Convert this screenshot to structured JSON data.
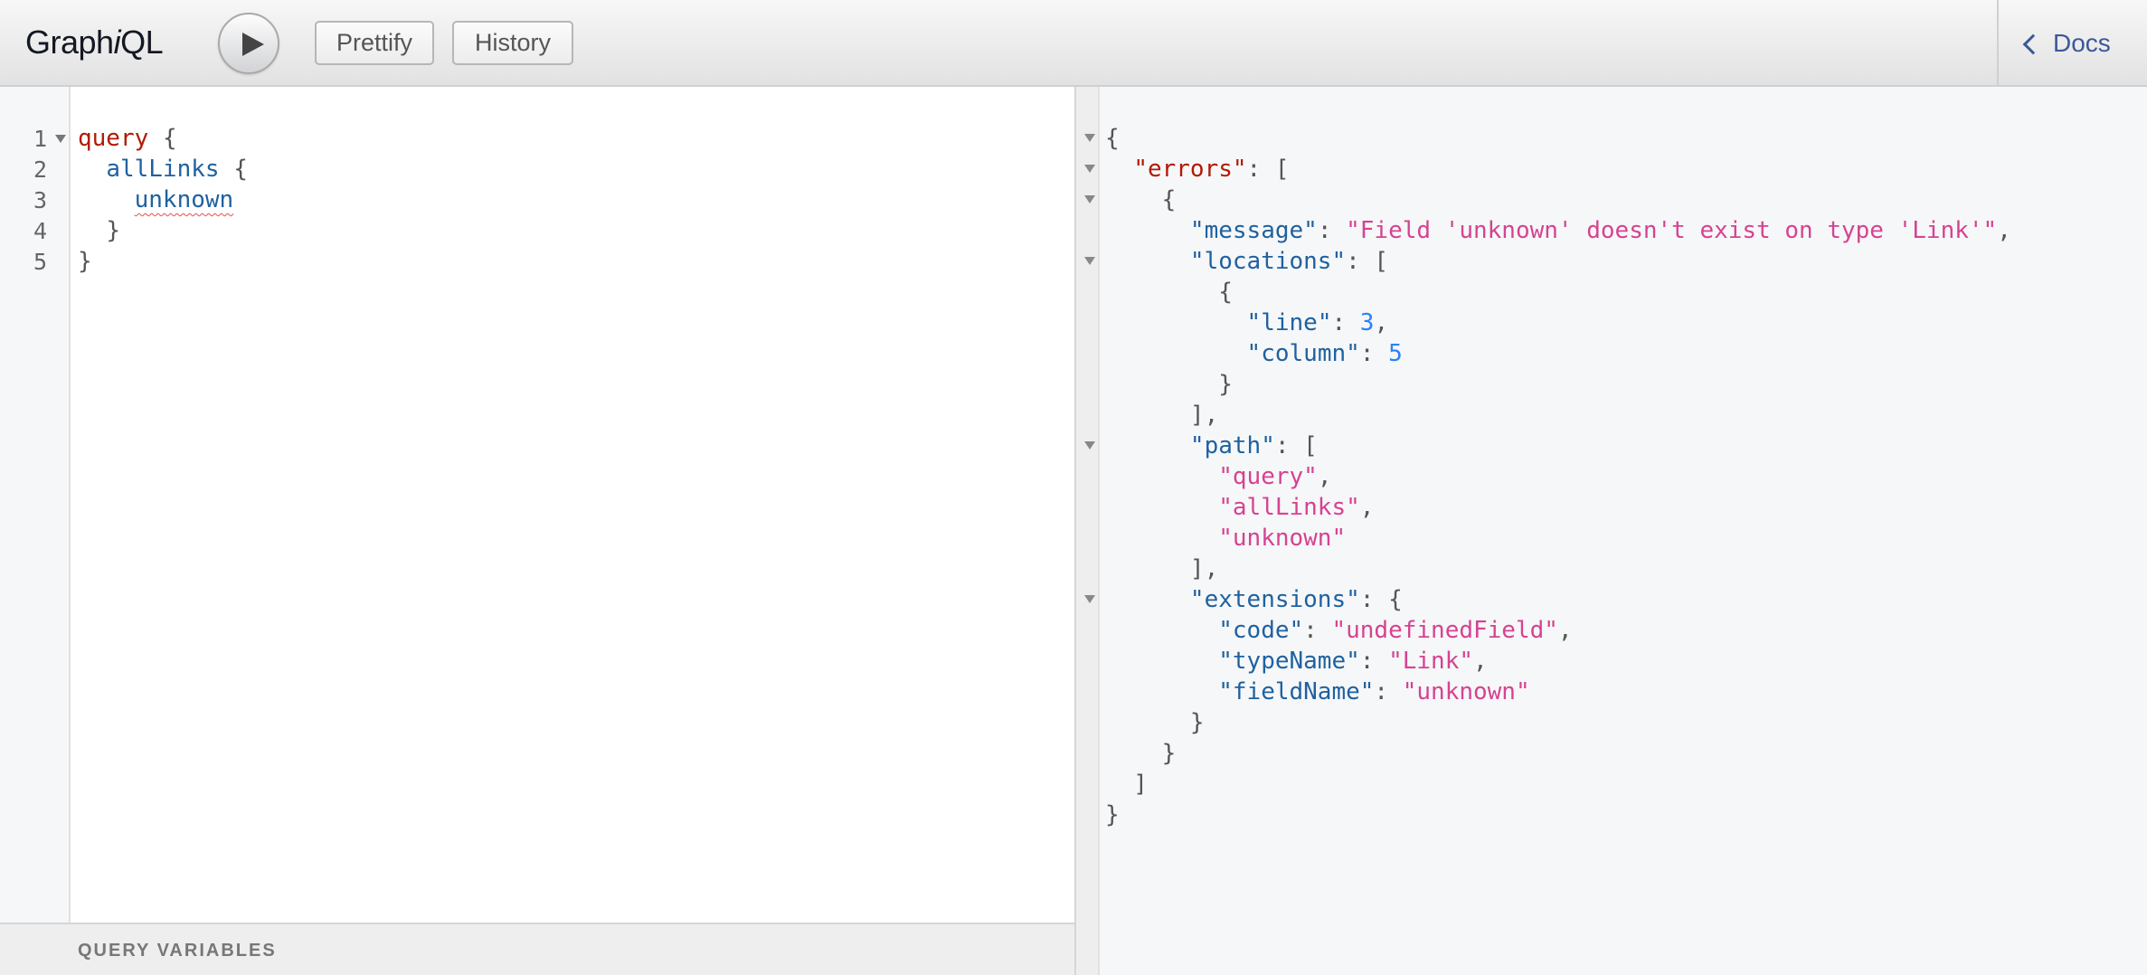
{
  "header": {
    "title_part1": "Graph",
    "title_italic": "i",
    "title_part2": "QL",
    "prettify_label": "Prettify",
    "history_label": "History",
    "docs_label": "Docs"
  },
  "editor": {
    "line_numbers": [
      "1",
      "2",
      "3",
      "4",
      "5"
    ],
    "tokens": {
      "query_kw": "query",
      "open_brace": "{",
      "all_links": "allLinks",
      "unknown_field": "unknown",
      "close_brace": "}"
    }
  },
  "variables": {
    "label": "QUERY VARIABLES"
  },
  "result": {
    "errors_key": "\"errors\"",
    "message_key": "\"message\"",
    "message_value": "\"Field 'unknown' doesn't exist on type 'Link'\"",
    "locations_key": "\"locations\"",
    "line_key": "\"line\"",
    "line_value": "3",
    "column_key": "\"column\"",
    "column_value": "5",
    "path_key": "\"path\"",
    "path_values": [
      "\"query\"",
      "\"allLinks\"",
      "\"unknown\""
    ],
    "extensions_key": "\"extensions\"",
    "code_key": "\"code\"",
    "code_value": "\"undefinedField\"",
    "typename_key": "\"typeName\"",
    "typename_value": "\"Link\"",
    "fieldname_key": "\"fieldName\"",
    "fieldname_value": "\"unknown\""
  }
}
